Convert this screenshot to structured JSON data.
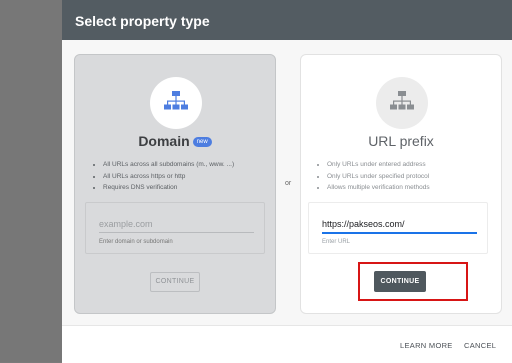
{
  "dialog": {
    "title": "Select property type",
    "or_label": "or"
  },
  "domain_card": {
    "title": "Domain",
    "badge": "new",
    "features": [
      "All URLs across all subdomains (m., www. ...)",
      "All URLs across https or http",
      "Requires DNS verification"
    ],
    "input_placeholder": "example.com",
    "input_helper": "Enter domain or subdomain",
    "continue_label": "CONTINUE"
  },
  "url_card": {
    "title": "URL prefix",
    "features": [
      "Only URLs under entered address",
      "Only URLs under specified protocol",
      "Allows multiple verification methods"
    ],
    "input_value": "https://pakseos.com/",
    "input_helper": "Enter URL",
    "continue_label": "CONTINUE"
  },
  "footer": {
    "learn_more": "LEARN MORE",
    "cancel": "CANCEL"
  },
  "colors": {
    "header": "#535c62",
    "badge": "#4d7de0",
    "focus_line": "#1a73e8",
    "highlight": "#d71515",
    "primary_button": "#4f585e"
  },
  "icons": {
    "domain": "sitemap-icon",
    "url_prefix": "sitemap-icon"
  }
}
